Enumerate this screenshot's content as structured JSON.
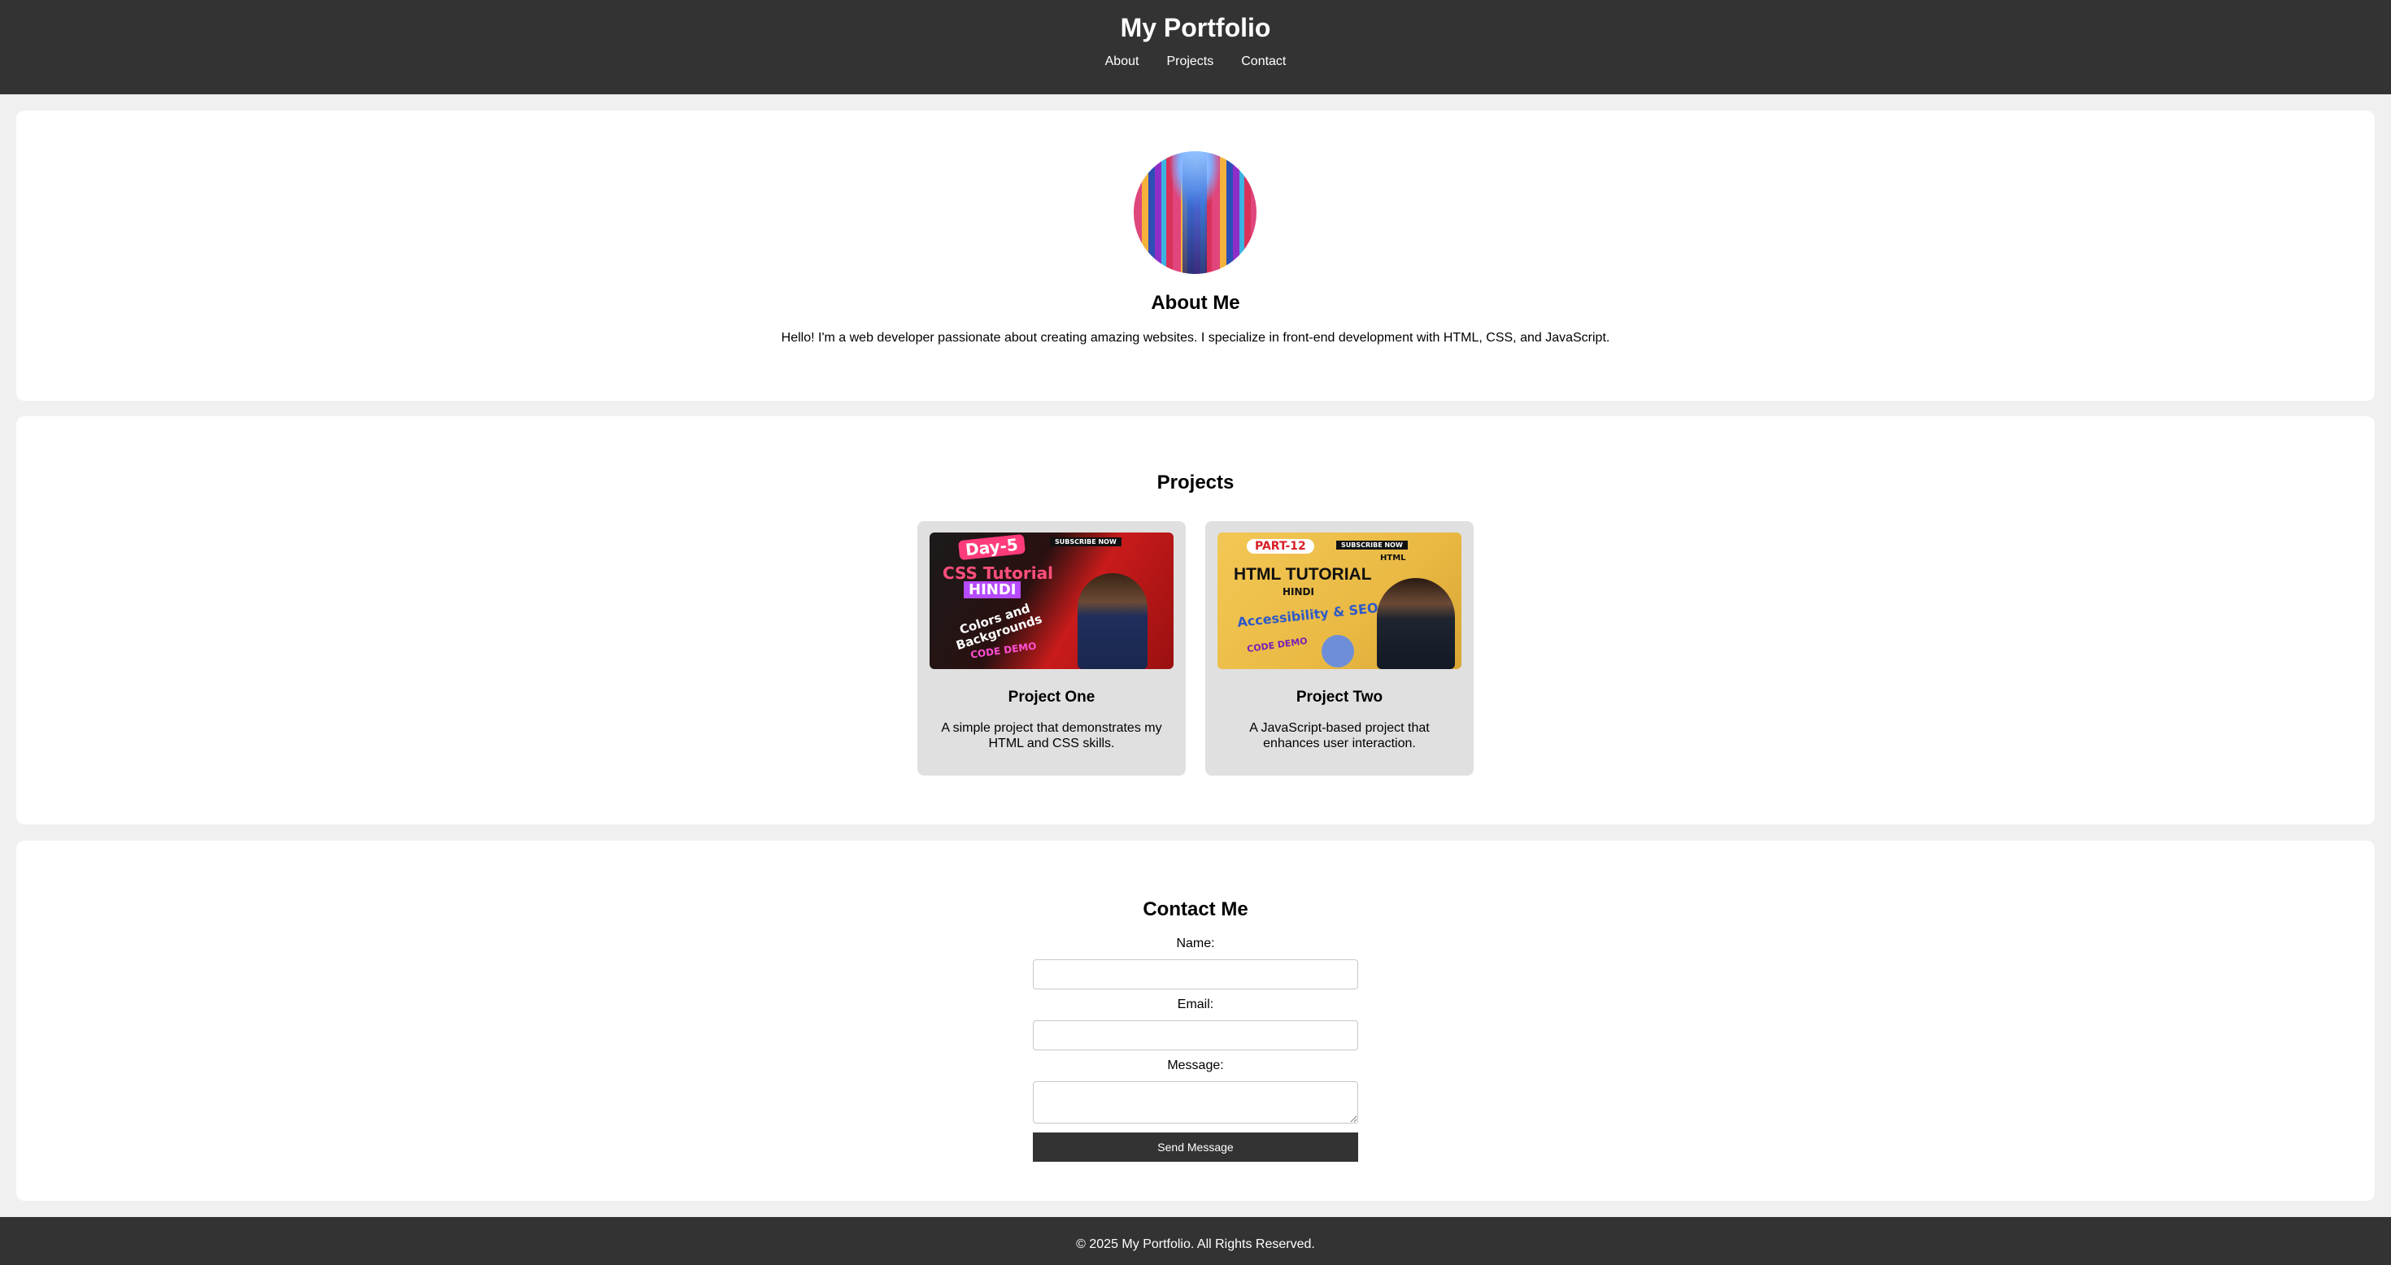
{
  "header": {
    "title": "My Portfolio",
    "nav": [
      "About",
      "Projects",
      "Contact"
    ]
  },
  "about": {
    "title": "About Me",
    "text": "Hello! I'm a web developer passionate about creating amazing websites. I specialize in front-end development with HTML, CSS, and JavaScript."
  },
  "projects": {
    "title": "Projects",
    "items": [
      {
        "title": "Project One",
        "description": "A simple project that demonstrates my HTML and CSS skills.",
        "thumbnail_text": [
          "Day-5",
          "CSS Tutorial",
          "HINDI",
          "Colors and Backgrounds",
          "CODE DEMO",
          "SUBSCRIBE NOW"
        ]
      },
      {
        "title": "Project Two",
        "description": "A JavaScript-based project that enhances user interaction.",
        "thumbnail_text": [
          "PART-12",
          "HTML TUTORIAL",
          "HINDI",
          "Accessibility & SEO",
          "CODE DEMO",
          "SUBSCRIBE NOW",
          "HTML"
        ]
      }
    ]
  },
  "contact": {
    "title": "Contact Me",
    "name_label": "Name:",
    "email_label": "Email:",
    "message_label": "Message:",
    "name_value": "",
    "email_value": "",
    "message_value": "",
    "submit_label": "Send Message"
  },
  "footer": {
    "text": "© 2025 My Portfolio. All Rights Reserved."
  },
  "colors": {
    "header_bg": "#333333",
    "page_bg": "#f0f0f0",
    "card_bg": "#e0e0e0",
    "button_bg": "#333333"
  }
}
